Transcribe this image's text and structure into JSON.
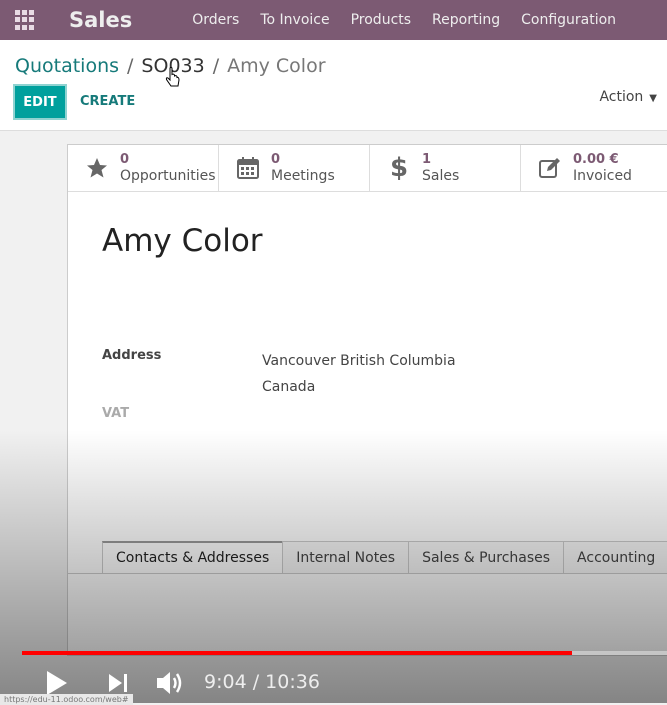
{
  "navbar": {
    "app_name": "Sales",
    "menu": [
      "Orders",
      "To Invoice",
      "Products",
      "Reporting",
      "Configuration"
    ]
  },
  "breadcrumb": {
    "root": "Quotations",
    "middle": "SO033",
    "current": "Amy Color",
    "separator": "/"
  },
  "buttons": {
    "edit": "EDIT",
    "create": "CREATE",
    "action": "Action"
  },
  "stats": [
    {
      "value": "0",
      "label": "Opportunities",
      "icon": "star-icon"
    },
    {
      "value": "0",
      "label": "Meetings",
      "icon": "calendar-icon"
    },
    {
      "value": "1",
      "label": "Sales",
      "icon": "dollar-icon"
    },
    {
      "value": "0.00 €",
      "label": "Invoiced",
      "icon": "edit-icon"
    }
  ],
  "partner": {
    "name": "Amy Color",
    "address_label": "Address",
    "address_line1": "Vancouver  British Columbia",
    "address_line2": "Canada",
    "vat_label": "VAT"
  },
  "tabs": [
    "Contacts & Addresses",
    "Internal Notes",
    "Sales & Purchases",
    "Accounting"
  ],
  "video": {
    "time": "9:04 / 10:36",
    "progress_fraction": 0.853
  },
  "status_url": "https://edu-11.odoo.com/web#",
  "colors": {
    "navbar": "#7c5a73",
    "primary": "#00a09d",
    "link": "#167a7a",
    "progress": "#ff0000"
  }
}
